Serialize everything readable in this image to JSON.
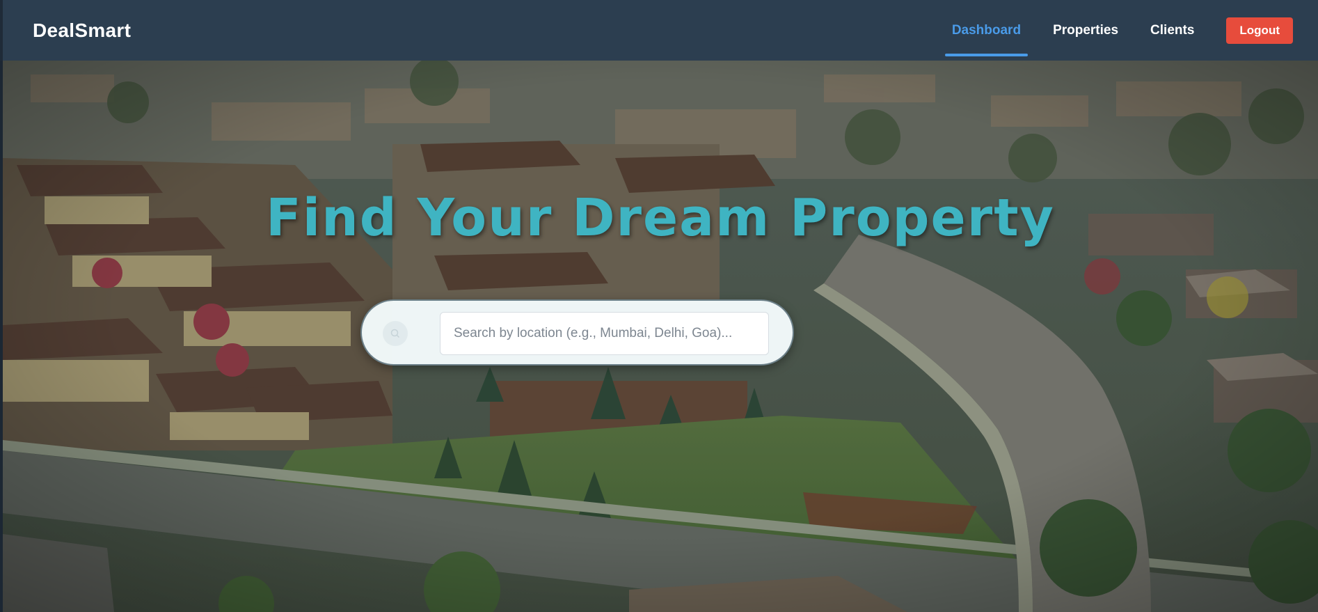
{
  "nav": {
    "brand": "DealSmart",
    "links": [
      {
        "label": "Dashboard",
        "active": true
      },
      {
        "label": "Properties",
        "active": false
      },
      {
        "label": "Clients",
        "active": false
      }
    ],
    "logout_label": "Logout"
  },
  "hero": {
    "title": "Find Your Dream Property",
    "search": {
      "placeholder": "Search by location (e.g., Mumbai, Delhi, Goa)...",
      "value": ""
    }
  },
  "colors": {
    "navbar": "#2c3e50",
    "active_link": "#4a9be8",
    "logout": "#e74c3c",
    "title": "#3fb4c2"
  }
}
